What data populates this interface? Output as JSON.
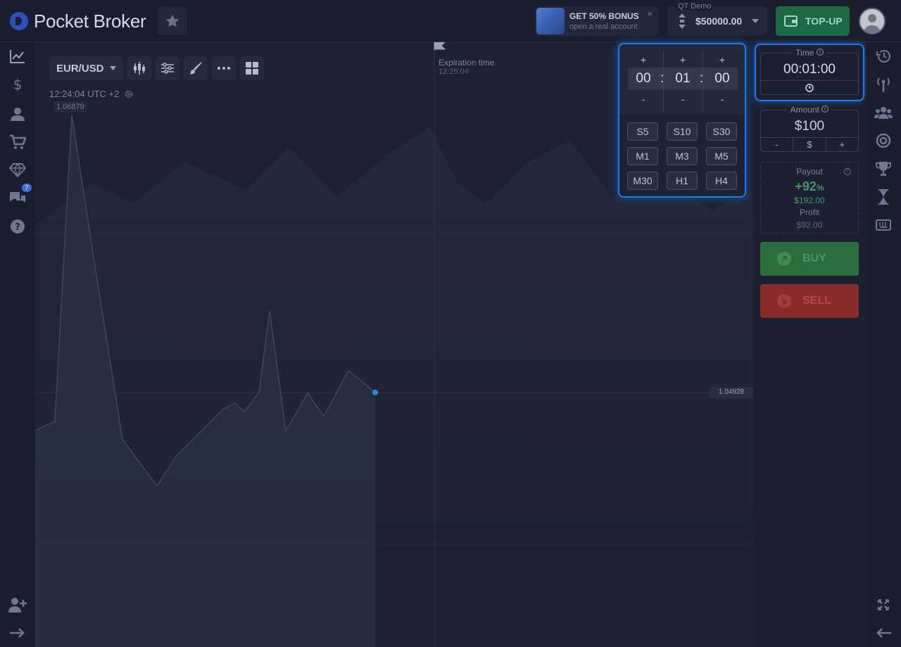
{
  "header": {
    "brand": "Pocket Broker",
    "bonus_title": "GET 50% BONUS",
    "bonus_subtitle": "open a real account",
    "bonus_close": "×",
    "account_type": "QT Demo",
    "balance": "$50000.00",
    "topup_label": "TOP-UP"
  },
  "sidebar_left": {
    "chat_badge": "7",
    "items": [
      "trading-chart-icon",
      "finance-icon",
      "profile-icon",
      "market-icon",
      "achievements-icon",
      "chat-icon",
      "help-icon"
    ],
    "bottom_items": [
      "add-user-icon",
      "logout-icon"
    ]
  },
  "sidebar_right": {
    "items": [
      "history-icon",
      "signals-icon",
      "social-trading-icon",
      "express-trades-icon",
      "tournaments-icon",
      "pending-trades-icon",
      "hotkeys-icon"
    ],
    "bottom_items": [
      "fullscreen-icon",
      "collapse-icon"
    ]
  },
  "chart": {
    "pair": "EUR/USD",
    "server_time": "12:24:04 UTC +2",
    "expiration_label": "Expiration time",
    "expiration_value": "12:25:04",
    "current_price": "1.04928",
    "max_price": "1.06879"
  },
  "expiration_popup": {
    "plus": "+",
    "minus": "-",
    "hours": "00",
    "minutes": "01",
    "seconds": "00",
    "separator": ":",
    "presets": [
      "S5",
      "S10",
      "S30",
      "M1",
      "M3",
      "M5",
      "M30",
      "H1",
      "H4"
    ]
  },
  "trade_panel": {
    "time_label": "Time",
    "time_value": "00:01:00",
    "amount_label": "Amount",
    "amount_value": "$100",
    "amount_minus": "-",
    "amount_currency": "$",
    "amount_plus": "+",
    "payout_label": "Payout",
    "payout_percent": "+92",
    "payout_percent_sign": "%",
    "payout_amount": "$192.00",
    "profit_label": "Profit",
    "profit_amount": "$92.00",
    "buy_label": "BUY",
    "sell_label": "SELL"
  },
  "colors": {
    "accent_highlight": "#1b7cf0",
    "buy": "#2b6d3c",
    "sell": "#8a2b2b",
    "topup": "#1b6a45"
  }
}
